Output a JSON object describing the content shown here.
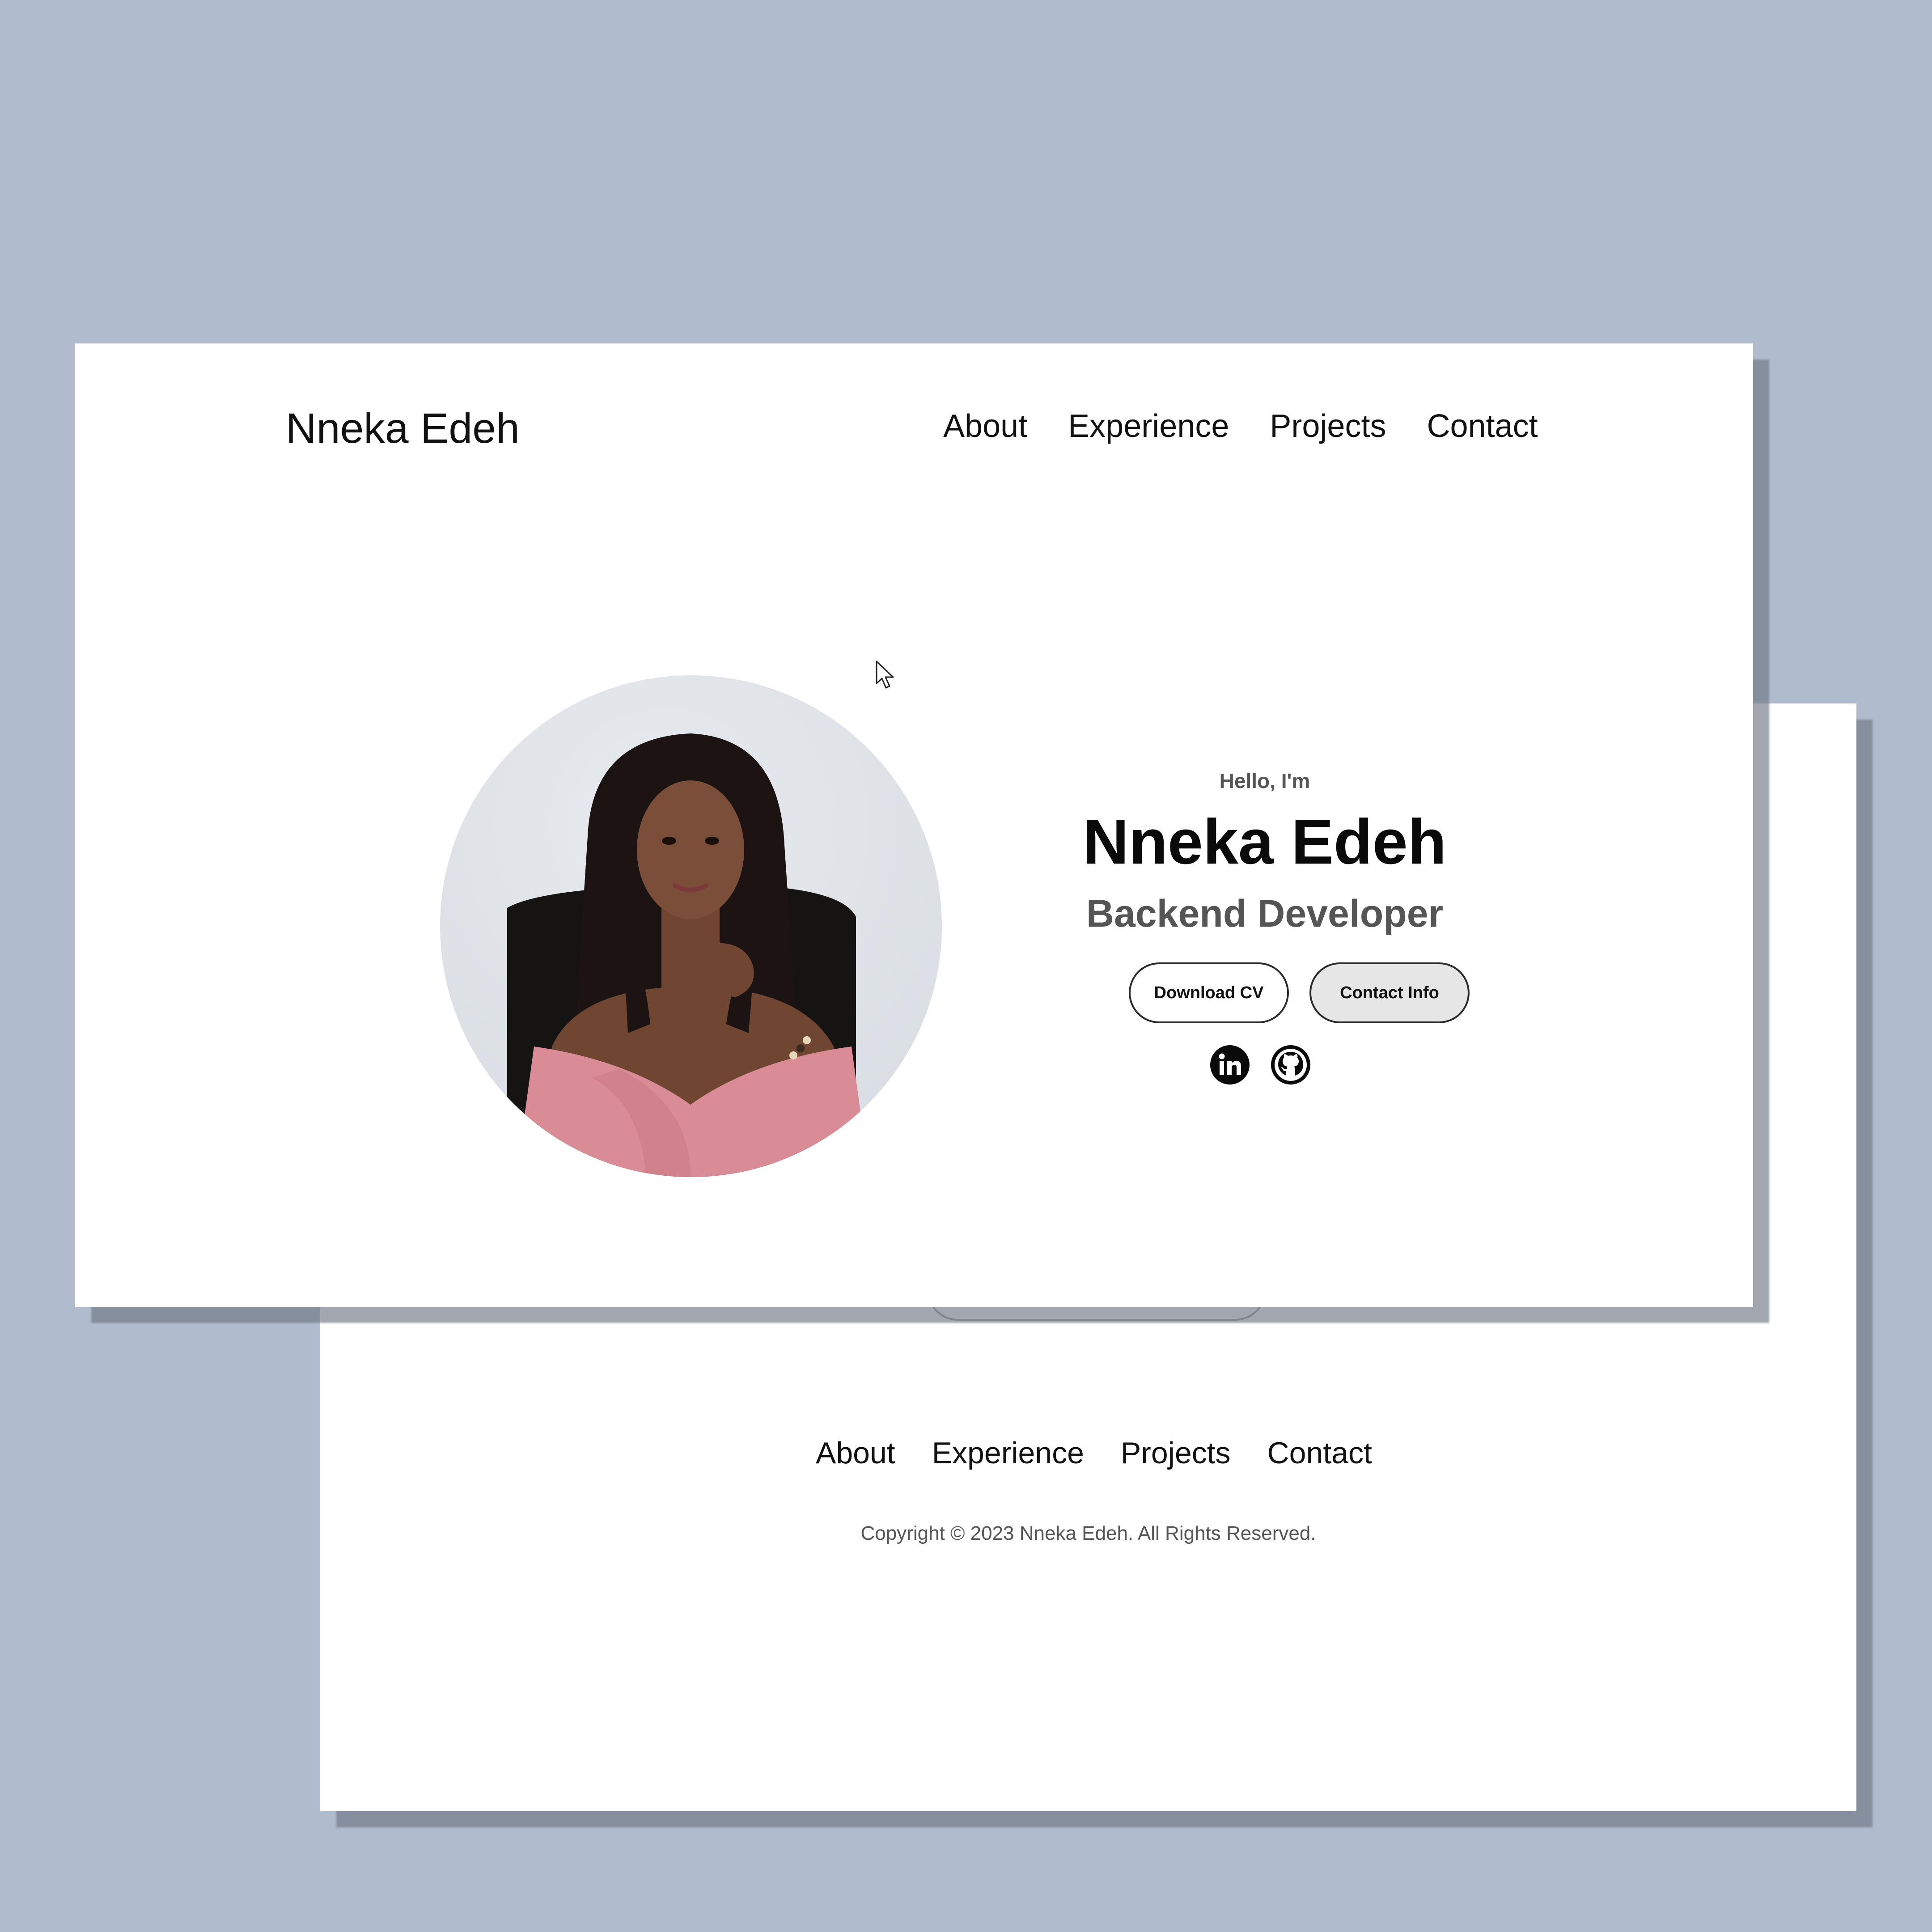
{
  "header": {
    "logo": "Nneka Edeh",
    "nav": [
      "About",
      "Experience",
      "Projects",
      "Contact"
    ]
  },
  "hero": {
    "greeting": "Hello, I'm",
    "name": "Nneka Edeh",
    "role": "Backend Developer",
    "buttons": {
      "download_cv": "Download CV",
      "contact_info": "Contact Info"
    },
    "social_icons": [
      "linkedin-icon",
      "github-icon"
    ]
  },
  "footer": {
    "nav": [
      "About",
      "Experience",
      "Projects",
      "Contact"
    ],
    "copyright": "Copyright © 2023 Nneka Edeh. All Rights Reserved."
  },
  "colors": {
    "background": "#b0bcce",
    "card": "#ffffff",
    "text_primary": "#111111",
    "text_secondary": "#555555",
    "button_secondary_bg": "#e6e6e6",
    "dress": "#d98c96",
    "hair": "#1c1412",
    "skin": "#6e4632"
  }
}
